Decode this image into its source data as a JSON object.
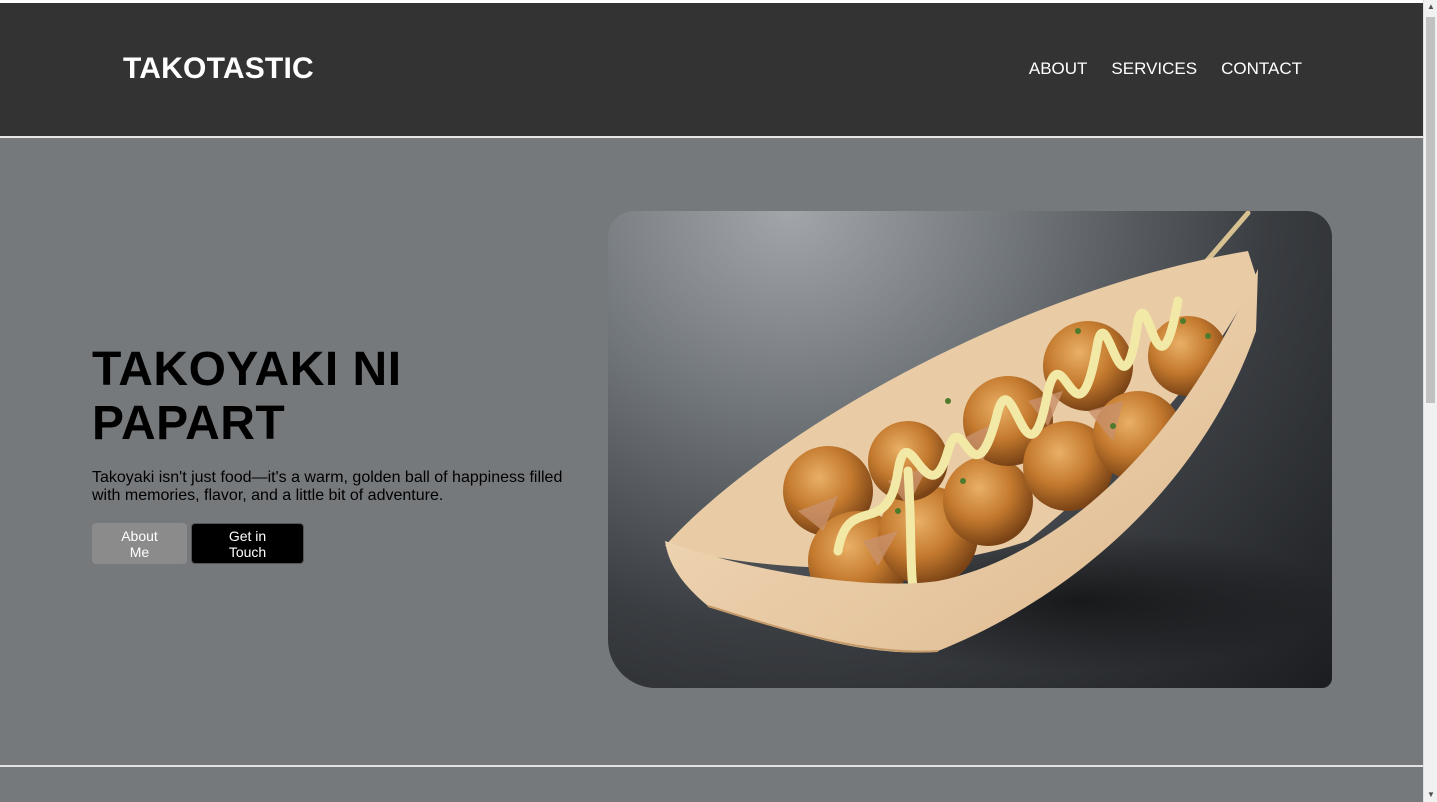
{
  "header": {
    "brand": "TAKOTASTIC",
    "nav": [
      "ABOUT",
      "SERVICES",
      "CONTACT"
    ]
  },
  "hero": {
    "title": "TAKOYAKI NI PAPART",
    "description": "Takoyaki isn't just food—it's a warm, golden ball of happiness filled with memories, flavor, and a little bit of adventure.",
    "buttons": {
      "about": "About Me",
      "contact": "Get in Touch"
    },
    "image_subject": "takoyaki-in-wooden-boat"
  },
  "colors": {
    "navbar": "#333333",
    "hero_bg": "#76797c",
    "button_about": "#8b8b8b",
    "button_touch": "#000000"
  },
  "scrollbar": {
    "position_fraction": 0.0
  }
}
